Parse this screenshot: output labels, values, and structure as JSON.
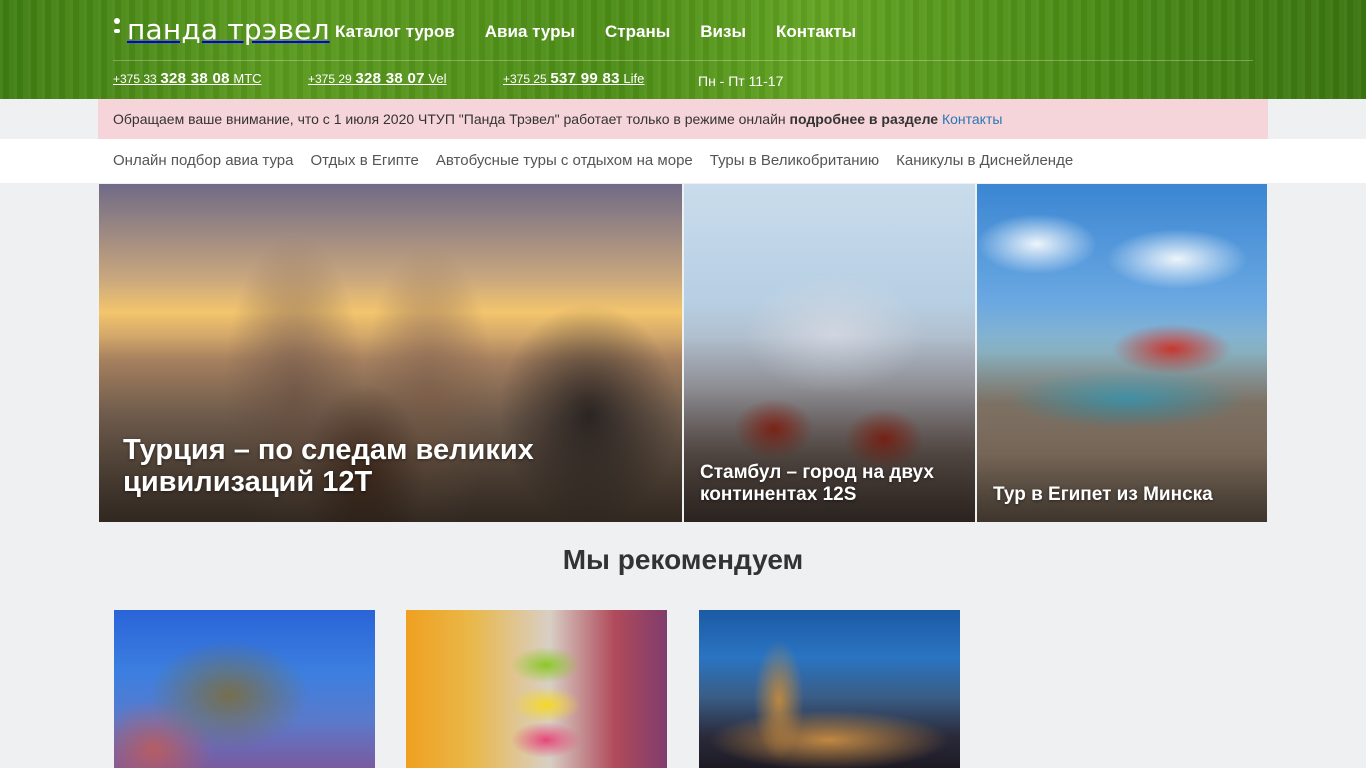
{
  "header": {
    "logo_text": "панда трэвел",
    "nav": [
      "Каталог туров",
      "Авиа туры",
      "Страны",
      "Визы",
      "Контакты"
    ],
    "phones": [
      {
        "code": "+375 33",
        "number": "328 38 08",
        "operator": "МТС"
      },
      {
        "code": "+375 29",
        "number": "328 38 07",
        "operator": "Vel"
      },
      {
        "code": "+375 25",
        "number": "537 99 83",
        "operator": "Life"
      }
    ],
    "hours": "Пн - Пт 11-17"
  },
  "notice": {
    "text": "Обращаем ваше внимание, что с 1 июля 2020 ЧТУП \"Панда Трэвел\" работает только в режиме онлайн ",
    "bold": "подробнее в разделе",
    "link": "Контакты"
  },
  "quick_links": [
    "Онлайн подбор авиа тура",
    "Отдых в Египте",
    "Автобусные туры с отдыхом на море",
    "Туры в Великобританию",
    "Каникулы в Диснейленде"
  ],
  "hero": [
    {
      "title": "Турция – по следам великих цивилизаций 12T"
    },
    {
      "title": "Стамбул – город на двух континентах 12S"
    },
    {
      "title": "Тур в Египет из Минска"
    }
  ],
  "recommend": {
    "title": "Мы рекомендуем"
  },
  "colors": {
    "header_green": "#4d8d17",
    "notice_bg": "#f6d5da",
    "link_blue": "#2a77b3",
    "page_bg": "#eff0f2"
  }
}
